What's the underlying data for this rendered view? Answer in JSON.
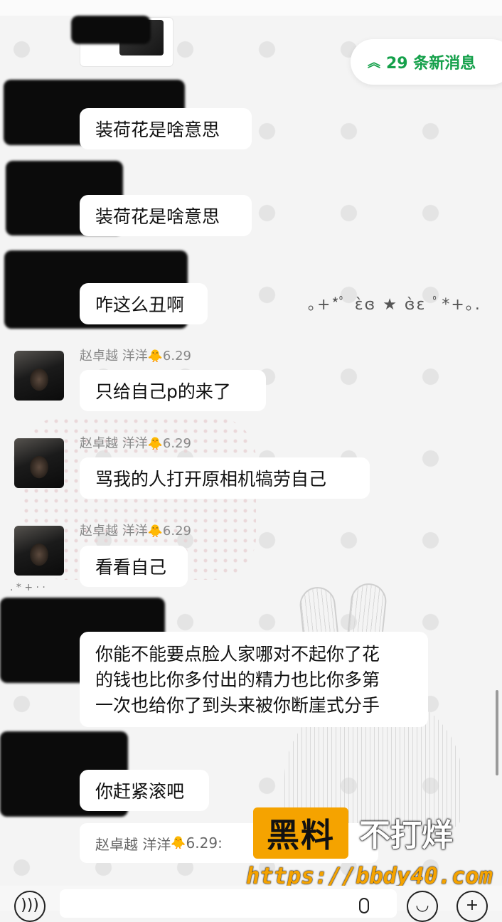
{
  "banner": {
    "new_messages": "29 条新消息",
    "chevron_icon": "double-chevron-up-icon"
  },
  "messages": [
    {
      "text": "装荷花是啥意思"
    },
    {
      "text": "装荷花是啥意思"
    },
    {
      "text": "咋这么丑啊"
    },
    {
      "sender": "赵卓越  洋洋",
      "chick": "🐥",
      "date": "6.29",
      "text": "只给自己p的来了"
    },
    {
      "sender": "赵卓越  洋洋",
      "chick": "🐥",
      "date": "6.29",
      "text": "骂我的人打开原相机犒劳自己"
    },
    {
      "sender": "赵卓越  洋洋",
      "chick": "🐥",
      "date": "6.29",
      "text": "看看自己"
    },
    {
      "lines": [
        "你能不能要点脸人家哪对不起你了花",
        "的钱也比你多付出的精力也比你多第",
        "一次也给你了到头来被你断崖式分手"
      ]
    },
    {
      "text": "你赶紧滚吧"
    }
  ],
  "decoration": {
    "kaomoji": "｡+*ﾟ ɛ̀ɞ ★ ɞ̀ɛ ﾟ*+｡.",
    "stars": ". *     +    ·  ·"
  },
  "quote": {
    "sender": "赵卓越  洋洋",
    "chick": "🐥",
    "text": "6.29:"
  },
  "watermark": {
    "brand": "黑料",
    "tagline": "不打烊",
    "url": "https://bbdy40.com"
  },
  "input_bar": {
    "voice_icon": "voice-icon",
    "mic_icon": "mic-icon",
    "emoji_icon": "emoji-icon",
    "plus_icon": "plus-icon",
    "plus": "+"
  },
  "colors": {
    "accent": "#14a04a",
    "watermark": "#f5a300"
  }
}
